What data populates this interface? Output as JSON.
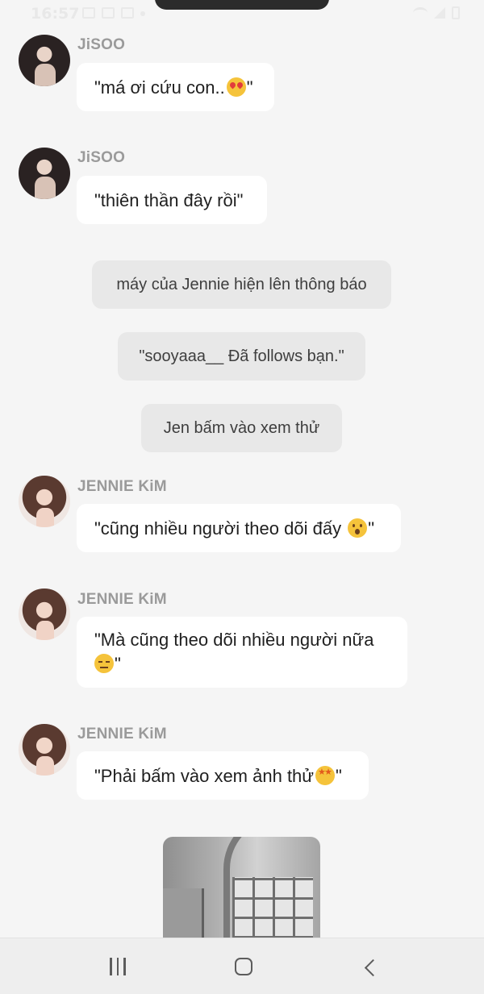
{
  "status_bar": {
    "time": "16:57"
  },
  "messages": [
    {
      "sender": "JiSOO",
      "text": "\"má ơi cứu con..",
      "emoji": "heart-eyes",
      "suffix": "\""
    },
    {
      "sender": "JiSOO",
      "text": "\"thiên thần đây rồi\"",
      "emoji": "",
      "suffix": ""
    }
  ],
  "system_messages": [
    "máy của Jennie hiện lên thông báo",
    "\"sooyaaa__ Đã follows bạn.\"",
    "Jen bấm vào xem thử"
  ],
  "jennie_messages": [
    {
      "sender": "JENNIE KiM",
      "text": "\"cũng nhiều người theo dõi đấy ",
      "emoji": "hushed",
      "suffix": "\""
    },
    {
      "sender": "JENNIE KiM",
      "line1": "\"Mà cũng theo dõi nhiều người nữa",
      "emoji": "expressionless",
      "suffix": "\""
    },
    {
      "sender": "JENNIE KiM",
      "text": "\"Phải bấm vào xem ảnh thử",
      "emoji": "star-struck",
      "suffix": "\""
    }
  ],
  "icons": {
    "recents": "recents-icon",
    "home": "home-icon",
    "back": "back-icon"
  }
}
